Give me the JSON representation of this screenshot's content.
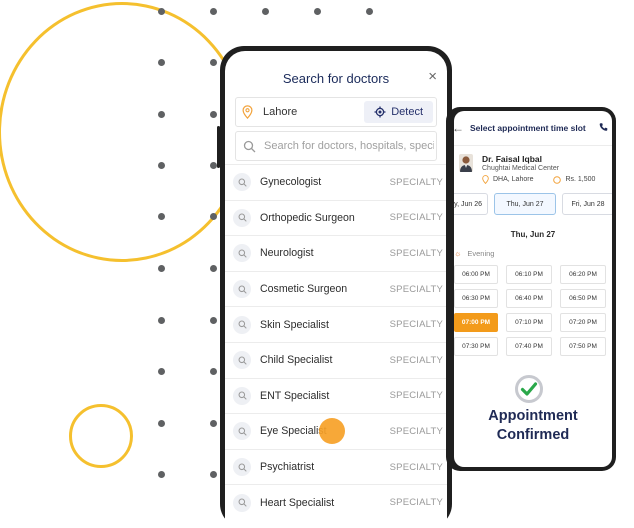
{
  "search_screen": {
    "title": "Search for doctors",
    "close_symbol": "×",
    "location": {
      "value": "Lahore",
      "detect_label": "Detect"
    },
    "search": {
      "placeholder": "Search for doctors, hospitals, specialties"
    },
    "items": [
      {
        "label": "Gynecologist",
        "tag": "SPECIALTY"
      },
      {
        "label": "Orthopedic Surgeon",
        "tag": "SPECIALTY"
      },
      {
        "label": "Neurologist",
        "tag": "SPECIALTY"
      },
      {
        "label": "Cosmetic Surgeon",
        "tag": "SPECIALTY"
      },
      {
        "label": "Skin Specialist",
        "tag": "SPECIALTY"
      },
      {
        "label": "Child Specialist",
        "tag": "SPECIALTY"
      },
      {
        "label": "ENT Specialist",
        "tag": "SPECIALTY"
      },
      {
        "label": "Eye Specialist",
        "tag": "SPECIALTY"
      },
      {
        "label": "Psychiatrist",
        "tag": "SPECIALTY"
      },
      {
        "label": "Heart Specialist",
        "tag": "SPECIALTY"
      }
    ]
  },
  "appointment_screen": {
    "back_symbol": "←",
    "title": "Select appointment time slot",
    "doctor": {
      "name": "Dr. Faisal Iqbal",
      "hospital": "Chughtai Medical Center",
      "location": "DHA, Lahore",
      "fee": "Rs. 1,500"
    },
    "dates": [
      "ay, Jun 26",
      "Thu, Jun 27",
      "Fri, Jun 28"
    ],
    "selected_date_heading": "Thu, Jun 27",
    "period": "Evening",
    "slots": [
      "06:00 PM",
      "06:10 PM",
      "06:20 PM",
      "06:30 PM",
      "06:40 PM",
      "06:50 PM",
      "07:00 PM",
      "07:10 PM",
      "07:20 PM",
      "07:30 PM",
      "07:40 PM",
      "07:50 PM"
    ],
    "active_slot": "07:00 PM",
    "confirmation": {
      "line1": "Appointment",
      "line2": "Confirmed"
    }
  },
  "colors": {
    "accent_yellow": "#f5c02e",
    "accent_orange": "#f39b1b",
    "navy": "#1f2a55",
    "check_green": "#2aa84a"
  }
}
